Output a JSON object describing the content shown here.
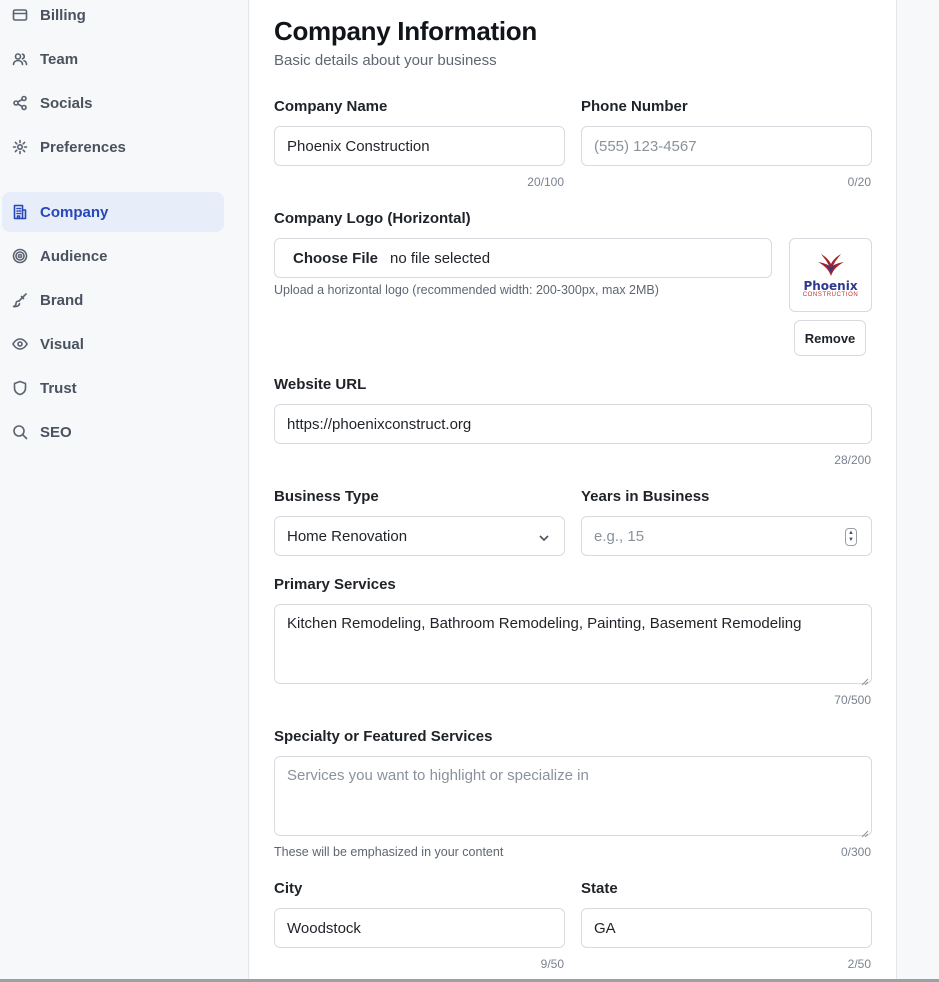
{
  "sidebar": {
    "items": [
      {
        "label": "Billing",
        "icon": "credit-card-icon",
        "active": false
      },
      {
        "label": "Team",
        "icon": "users-icon",
        "active": false
      },
      {
        "label": "Socials",
        "icon": "share-icon",
        "active": false
      },
      {
        "label": "Preferences",
        "icon": "gear-icon",
        "active": false
      },
      {
        "label": "Company",
        "icon": "building-icon",
        "active": true
      },
      {
        "label": "Audience",
        "icon": "target-icon",
        "active": false
      },
      {
        "label": "Brand",
        "icon": "brush-icon",
        "active": false
      },
      {
        "label": "Visual",
        "icon": "eye-icon",
        "active": false
      },
      {
        "label": "Trust",
        "icon": "shield-icon",
        "active": false
      },
      {
        "label": "SEO",
        "icon": "search-icon",
        "active": false
      }
    ]
  },
  "form": {
    "title": "Company Information",
    "subtitle": "Basic details about your business",
    "company_name": {
      "label": "Company Name",
      "value": "Phoenix Construction",
      "counter": "20/100"
    },
    "phone": {
      "label": "Phone Number",
      "placeholder": "(555) 123-4567",
      "counter": "0/20"
    },
    "logo": {
      "label": "Company Logo (Horizontal)",
      "choose_label": "Choose File",
      "file_status": "no file selected",
      "help": "Upload a horizontal logo (recommended width: 200-300px, max 2MB)",
      "preview_word": "Phoenix",
      "preview_sub": "CONSTRUCTION",
      "remove_label": "Remove"
    },
    "website": {
      "label": "Website URL",
      "value": "https://phoenixconstruct.org",
      "counter": "28/200"
    },
    "business_type": {
      "label": "Business Type",
      "value": "Home Renovation"
    },
    "years": {
      "label": "Years in Business",
      "placeholder": "e.g., 15"
    },
    "primary_services": {
      "label": "Primary Services",
      "value": "Kitchen Remodeling, Bathroom Remodeling, Painting, Basement Remodeling",
      "counter": "70/500"
    },
    "specialty": {
      "label": "Specialty or Featured Services",
      "placeholder": "Services you want to highlight or specialize in",
      "help": "These will be emphasized in your content",
      "counter": "0/300"
    },
    "city": {
      "label": "City",
      "value": "Woodstock",
      "counter": "9/50"
    },
    "state": {
      "label": "State",
      "value": "GA",
      "counter": "2/50"
    }
  },
  "colors": {
    "accent": "#2647b8",
    "active_bg": "#e7edf9",
    "border": "#d7dbe0"
  }
}
